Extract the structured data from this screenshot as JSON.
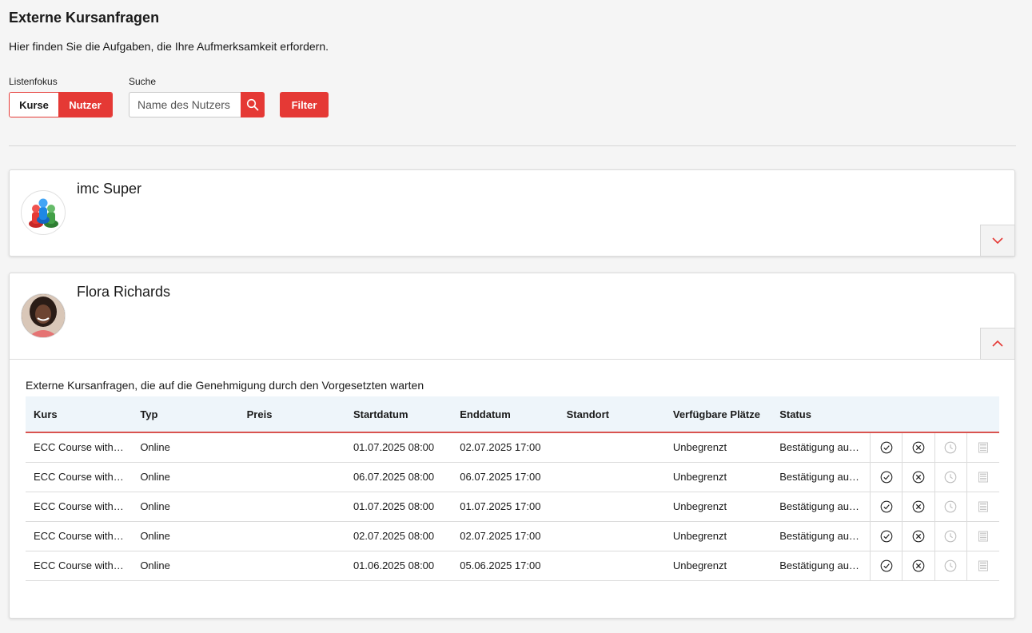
{
  "page": {
    "title": "Externe Kursanfragen",
    "subtitle": "Hier finden Sie die Aufgaben, die Ihre Aufmerksamkeit erfordern."
  },
  "controls": {
    "list_focus_label": "Listenfokus",
    "toggle": [
      "Kurse",
      "Nutzer"
    ],
    "toggle_active": "Nutzer",
    "search_label": "Suche",
    "search_placeholder": "Name des Nutzers",
    "search_value": "",
    "filter_label": "Filter"
  },
  "colors": {
    "accent": "#e53935",
    "header_bg": "#eef5fa"
  },
  "users": [
    {
      "name": "imc Super",
      "expanded": false,
      "toggle_icon": "chevron-down-icon"
    },
    {
      "name": "Flora Richards",
      "expanded": true,
      "toggle_icon": "chevron-up-icon"
    }
  ],
  "requests": {
    "section_title": "Externe Kursanfragen, die auf die Genehmigung durch den Vorgesetzten warten",
    "columns": [
      "Kurs",
      "Typ",
      "Preis",
      "Startdatum",
      "Enddatum",
      "Standort",
      "Verfügbare Plätze",
      "Status"
    ],
    "rows": [
      [
        "ECC Course with ...",
        "Online",
        "",
        "01.07.2025 08:00",
        "02.07.2025 17:00",
        "",
        "Unbegrenzt",
        "Bestätigung aus..."
      ],
      [
        "ECC Course with ...",
        "Online",
        "",
        "06.07.2025 08:00",
        "06.07.2025 17:00",
        "",
        "Unbegrenzt",
        "Bestätigung aus..."
      ],
      [
        "ECC Course with ...",
        "Online",
        "",
        "01.07.2025 08:00",
        "01.07.2025 17:00",
        "",
        "Unbegrenzt",
        "Bestätigung aus..."
      ],
      [
        "ECC Course with ...",
        "Online",
        "",
        "02.07.2025 08:00",
        "02.07.2025 17:00",
        "",
        "Unbegrenzt",
        "Bestätigung aus..."
      ],
      [
        "ECC Course with ...",
        "Online",
        "",
        "01.06.2025 08:00",
        "05.06.2025 17:00",
        "",
        "Unbegrenzt",
        "Bestätigung aus..."
      ]
    ],
    "row_actions": [
      "approve-icon",
      "reject-icon",
      "clock-icon",
      "details-icon"
    ]
  }
}
